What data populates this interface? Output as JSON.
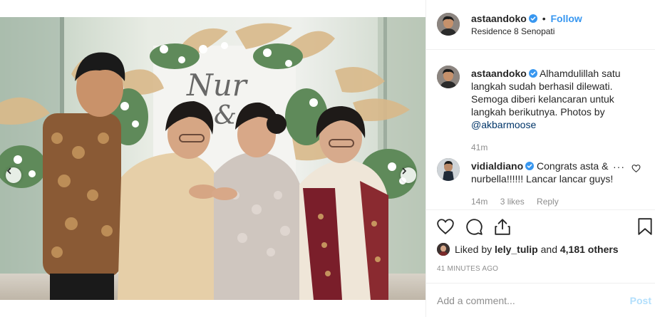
{
  "header": {
    "username": "astaandoko",
    "separator": "•",
    "follow_label": "Follow",
    "location": "Residence 8 Senopati"
  },
  "caption": {
    "username": "astaandoko",
    "text": "Alhamdulillah satu langkah sudah berhasil dilewati. Semoga diberi kelancaran untuk langkah berikutnya. Photos by",
    "mention": "@akbarmoose",
    "time": "41m"
  },
  "comments": [
    {
      "username": "vidialdiano",
      "text": "Congrats asta & nurbella!!!!!! Lancar lancar guys!",
      "time": "14m",
      "likes": "3 likes",
      "reply_label": "Reply"
    }
  ],
  "liked_by": {
    "prefix": "Liked by",
    "user": "lely_tulip",
    "conj": "and",
    "count_label": "4,181 others"
  },
  "timestamp": "41 minutes ago",
  "add_comment": {
    "placeholder": "Add a comment...",
    "post_label": "Post"
  },
  "carousel": {
    "dot_count": 5,
    "active_index": 4
  },
  "colors": {
    "link_blue": "#3897f0",
    "verified_blue": "#3897f0",
    "post_disabled": "#b2dffc",
    "muted": "#8e8e8e"
  }
}
